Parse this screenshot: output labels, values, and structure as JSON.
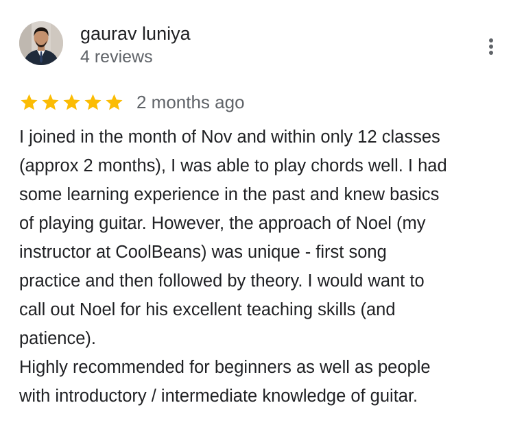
{
  "review": {
    "reviewer": {
      "name": "gaurav luniya",
      "review_count": "4 reviews",
      "avatar_icon": "person-avatar-icon"
    },
    "more_menu_icon": "more-vert-icon",
    "rating": {
      "stars": 5,
      "max_stars": 5,
      "star_color": "#fbbc04",
      "date": "2 months ago"
    },
    "text": {
      "line1": "I joined in the month of Nov and within only 12 classes\n(approx 2 months), I was able to play chords well. I had\nsome learning experience in the past and knew basics\nof playing guitar. However, the approach of Noel (my\ninstructor at CoolBeans) was unique - first song\npractice and then followed by theory. I would want to\ncall out Noel for his excellent teaching skills (and\npatience).",
      "line2": "Highly recommended for beginners as well as people\nwith introductory / intermediate knowledge of guitar."
    }
  },
  "colors": {
    "primary_text": "#202124",
    "secondary_text": "#5f6368",
    "star": "#fbbc04"
  }
}
